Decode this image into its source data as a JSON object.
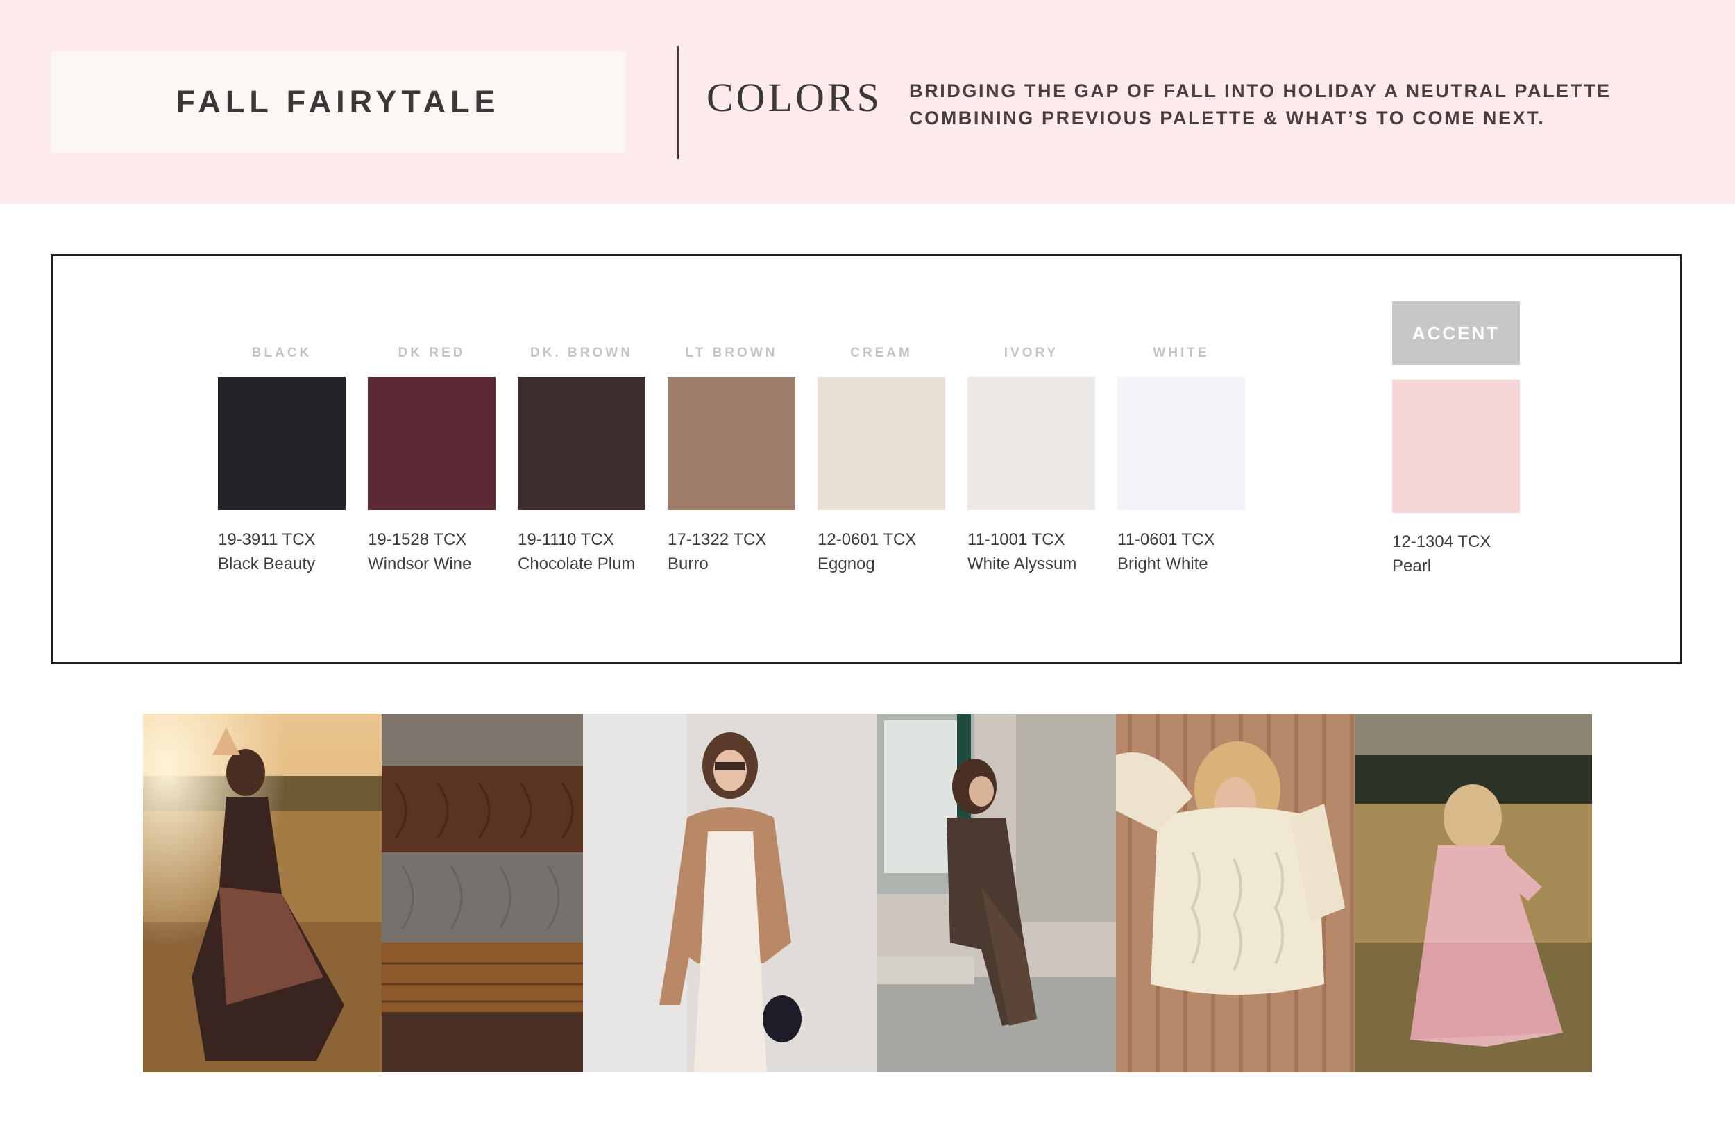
{
  "header": {
    "title": "FALL FAIRYTALE",
    "section": "COLORS",
    "description_lines": [
      "BRIDGING THE GAP OF FALL INTO HOLIDAY A NEUTRAL PALETTE",
      "COMBINING PREVIOUS PALETTE & WHAT’S TO COME NEXT."
    ]
  },
  "palette": {
    "swatches": [
      {
        "label": "BLACK",
        "code": "19-3911 TCX",
        "name": "Black Beauty",
        "color": "#232427"
      },
      {
        "label": "DK RED",
        "code": "19-1528 TCX",
        "name": "Windsor Wine",
        "color": "#5b2a35"
      },
      {
        "label": "DK. BROWN",
        "code": "19-1110 TCX",
        "name": "Chocolate Plum",
        "color": "#3c2d2d"
      },
      {
        "label": "LT BROWN",
        "code": "17-1322 TCX",
        "name": "Burro",
        "color": "#9d7d69"
      },
      {
        "label": "CREAM",
        "code": "12-0601 TCX",
        "name": "Eggnog",
        "color": "#ebe0d6"
      },
      {
        "label": "IVORY",
        "code": "11-1001 TCX",
        "name": "White Alyssum",
        "color": "#ece8e5"
      },
      {
        "label": "WHITE",
        "code": "11-0601 TCX",
        "name": "Bright White",
        "color": "#f3f4f8"
      }
    ],
    "accent": {
      "label": "ACCENT",
      "code": "12-1304 TCX",
      "name": "Pearl",
      "color": "#f5d5d5"
    }
  },
  "photos": [
    {
      "name": "photo-floral-dress-field"
    },
    {
      "name": "photo-knit-sweaters-stack"
    },
    {
      "name": "photo-tan-jacket-model"
    },
    {
      "name": "photo-seated-woman-street"
    },
    {
      "name": "photo-cream-cable-sweater"
    },
    {
      "name": "photo-pink-dress-meadow"
    }
  ]
}
